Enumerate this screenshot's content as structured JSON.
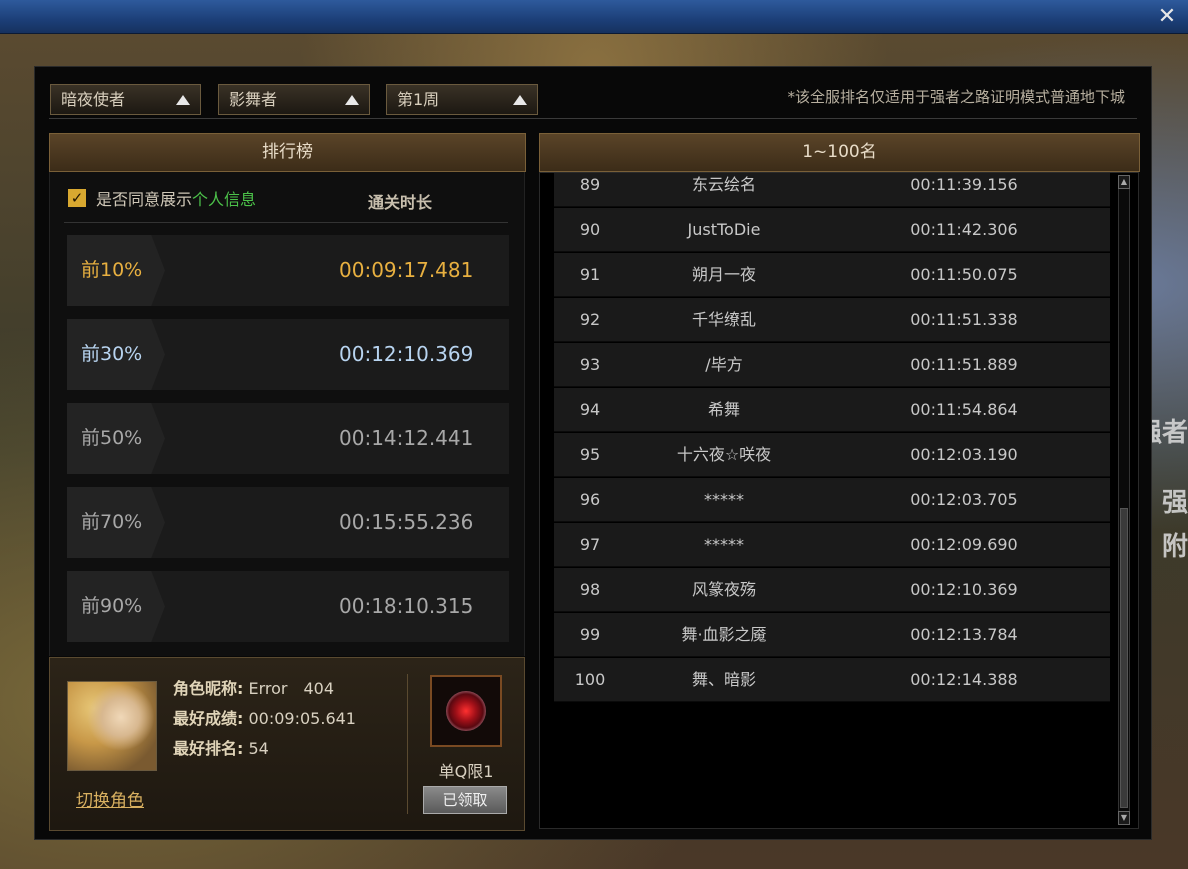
{
  "window": {
    "close_glyph": "✕"
  },
  "background": {
    "text1": "强者",
    "text2": "强",
    "text3": "附"
  },
  "filters": [
    {
      "label": "暗夜使者"
    },
    {
      "label": "影舞者"
    },
    {
      "label": "第1周"
    }
  ],
  "notice": "*该全服排名仅适用于强者之路证明模式普通地下城",
  "left": {
    "header": "排行榜",
    "agree_checked": true,
    "agree_text": "是否同意展示",
    "agree_highlight": "个人信息",
    "time_header": "通关时长",
    "percentiles": [
      {
        "label": "前10%",
        "time": "00:09:17.481",
        "color": "#e8b040"
      },
      {
        "label": "前30%",
        "time": "00:12:10.369",
        "color": "#b8d4f0"
      },
      {
        "label": "前50%",
        "time": "00:14:12.441",
        "color": "#a8a8a8"
      },
      {
        "label": "前70%",
        "time": "00:15:55.236",
        "color": "#a8a8a8"
      },
      {
        "label": "前90%",
        "time": "00:18:10.315",
        "color": "#a8a8a8"
      }
    ]
  },
  "profile": {
    "name_label": "角色昵称:",
    "name_value": "Error　404",
    "best_label": "最好成绩:",
    "best_value": "00:09:05.641",
    "rank_label": "最好排名:",
    "rank_value": "54",
    "switch_label": "切换角色",
    "reward_label": "单Q限1",
    "claim_label": "已领取"
  },
  "right": {
    "header": "1~100名",
    "rows": [
      {
        "rank": "89",
        "name": "东云绘名",
        "time": "00:11:39.156"
      },
      {
        "rank": "90",
        "name": "JustToDie",
        "time": "00:11:42.306"
      },
      {
        "rank": "91",
        "name": "朔月一夜",
        "time": "00:11:50.075"
      },
      {
        "rank": "92",
        "name": "千华缭乱",
        "time": "00:11:51.338"
      },
      {
        "rank": "93",
        "name": "/毕方",
        "time": "00:11:51.889"
      },
      {
        "rank": "94",
        "name": "希舞",
        "time": "00:11:54.864"
      },
      {
        "rank": "95",
        "name": "十六夜☆咲夜",
        "time": "00:12:03.190"
      },
      {
        "rank": "96",
        "name": "*****",
        "time": "00:12:03.705"
      },
      {
        "rank": "97",
        "name": "*****",
        "time": "00:12:09.690"
      },
      {
        "rank": "98",
        "name": "风篆夜殇",
        "time": "00:12:10.369"
      },
      {
        "rank": "99",
        "name": "舞·血影之魇",
        "time": "00:12:13.784"
      },
      {
        "rank": "100",
        "name": "舞、暗影",
        "time": "00:12:14.388"
      }
    ]
  }
}
